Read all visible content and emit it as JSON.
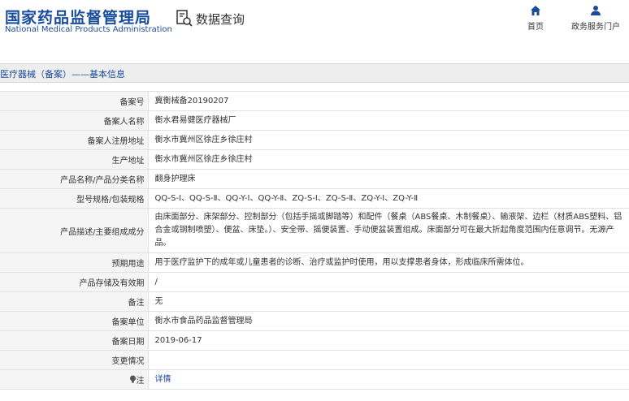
{
  "header": {
    "logo_cn": "国家药品监督管理局",
    "logo_en": "National Medical Products Administration",
    "query_label": "数据查询",
    "nav_home": "首页",
    "nav_service": "政务服务门户"
  },
  "breadcrumb": "医疗器械（备案）——基本信息",
  "rows": [
    {
      "label": "备案号",
      "value": "冀衡械备20190207"
    },
    {
      "label": "备案人名称",
      "value": "衡水君易健医疗器械厂"
    },
    {
      "label": "备案人注册地址",
      "value": "衡水市冀州区徐庄乡徐庄村"
    },
    {
      "label": "生产地址",
      "value": "衡水市冀州区徐庄乡徐庄村"
    },
    {
      "label": "产品名称/产品分类名称",
      "value": "翻身护理床"
    },
    {
      "label": "型号规格/包装规格",
      "value": "QQ-S-Ⅰ、QQ-S-Ⅱ、QQ-Y-Ⅰ、QQ-Y-Ⅱ、ZQ-S-Ⅰ、ZQ-S-Ⅱ、ZQ-Y-Ⅰ、ZQ-Y-Ⅱ"
    },
    {
      "label": "产品描述/主要组成成分",
      "value": "由床面部分、床架部分、控制部分（包括手摇或脚踏等）和配件（餐桌（ABS餐桌、木制餐桌）、输液架、边栏（材质ABS塑料、铝合金或钢制喷塑）、便盆、床垫。）、安全带、摇便装置、手动便盆装置组成。床面部分可在最大折起角度范围内任意调节。无源产品。"
    },
    {
      "label": "预期用途",
      "value": "用于医疗监护下的成年或儿童患者的诊断、治疗或监护时使用，用以支撑患者身体，形成临床所需体位。"
    },
    {
      "label": "产品存储及有效期",
      "value": "/"
    },
    {
      "label": "备注",
      "value": "无"
    },
    {
      "label": "备案单位",
      "value": "衡水市食品药品监督管理局"
    },
    {
      "label": "备案日期",
      "value": "2019-06-17"
    },
    {
      "label": "变更情况",
      "value": ""
    },
    {
      "label": "注",
      "value": "详情"
    }
  ],
  "colors": {
    "brand": "#1a4c9c",
    "label_bg": "#f5f5f5",
    "bar_bg": "#eeeeee"
  }
}
